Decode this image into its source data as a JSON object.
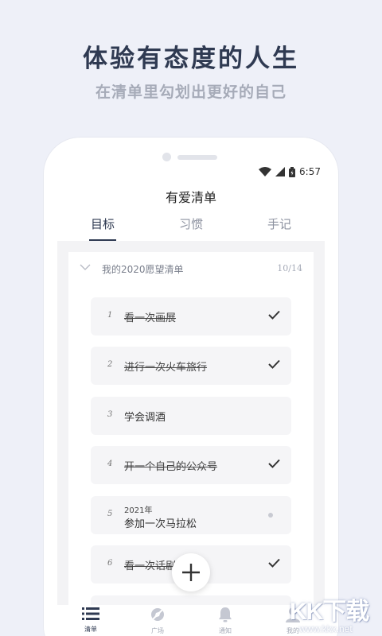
{
  "promo": {
    "headline": "体验有态度的人生",
    "subline": "在清单里勾划出更好的自己"
  },
  "status_bar": {
    "time": "6:57"
  },
  "app": {
    "title": "有爱清单",
    "tabs": [
      {
        "label": "目标",
        "active": true
      },
      {
        "label": "习惯",
        "active": false
      },
      {
        "label": "手记",
        "active": false
      }
    ]
  },
  "list": {
    "title": "我的2020愿望清单",
    "count": "10/14",
    "items": [
      {
        "num": "1",
        "text": "看一次画展",
        "done": true
      },
      {
        "num": "2",
        "text": "进行一次火车旅行",
        "done": true
      },
      {
        "num": "3",
        "text": "学会调酒",
        "done": false
      },
      {
        "num": "4",
        "text": "开一个自己的公众号",
        "done": true
      },
      {
        "num": "5",
        "year": "2021年",
        "text": "参加一次马拉松",
        "done": false
      },
      {
        "num": "6",
        "text": "看一次话剧",
        "done": true
      }
    ]
  },
  "bottom_nav": [
    {
      "label": "清单",
      "icon": "list-icon",
      "active": true
    },
    {
      "label": "广场",
      "icon": "compass-icon",
      "active": false
    },
    {
      "label": "通知",
      "icon": "bell-icon",
      "active": false
    },
    {
      "label": "我的",
      "icon": "user-icon",
      "active": false
    }
  ],
  "watermark": {
    "main": "KK下载",
    "url": "www.kkx.net"
  },
  "colors": {
    "background": "#eef0f8",
    "primary_text": "#2f3a52",
    "muted_text": "#a6abb8",
    "item_background": "#f5f5f7"
  }
}
